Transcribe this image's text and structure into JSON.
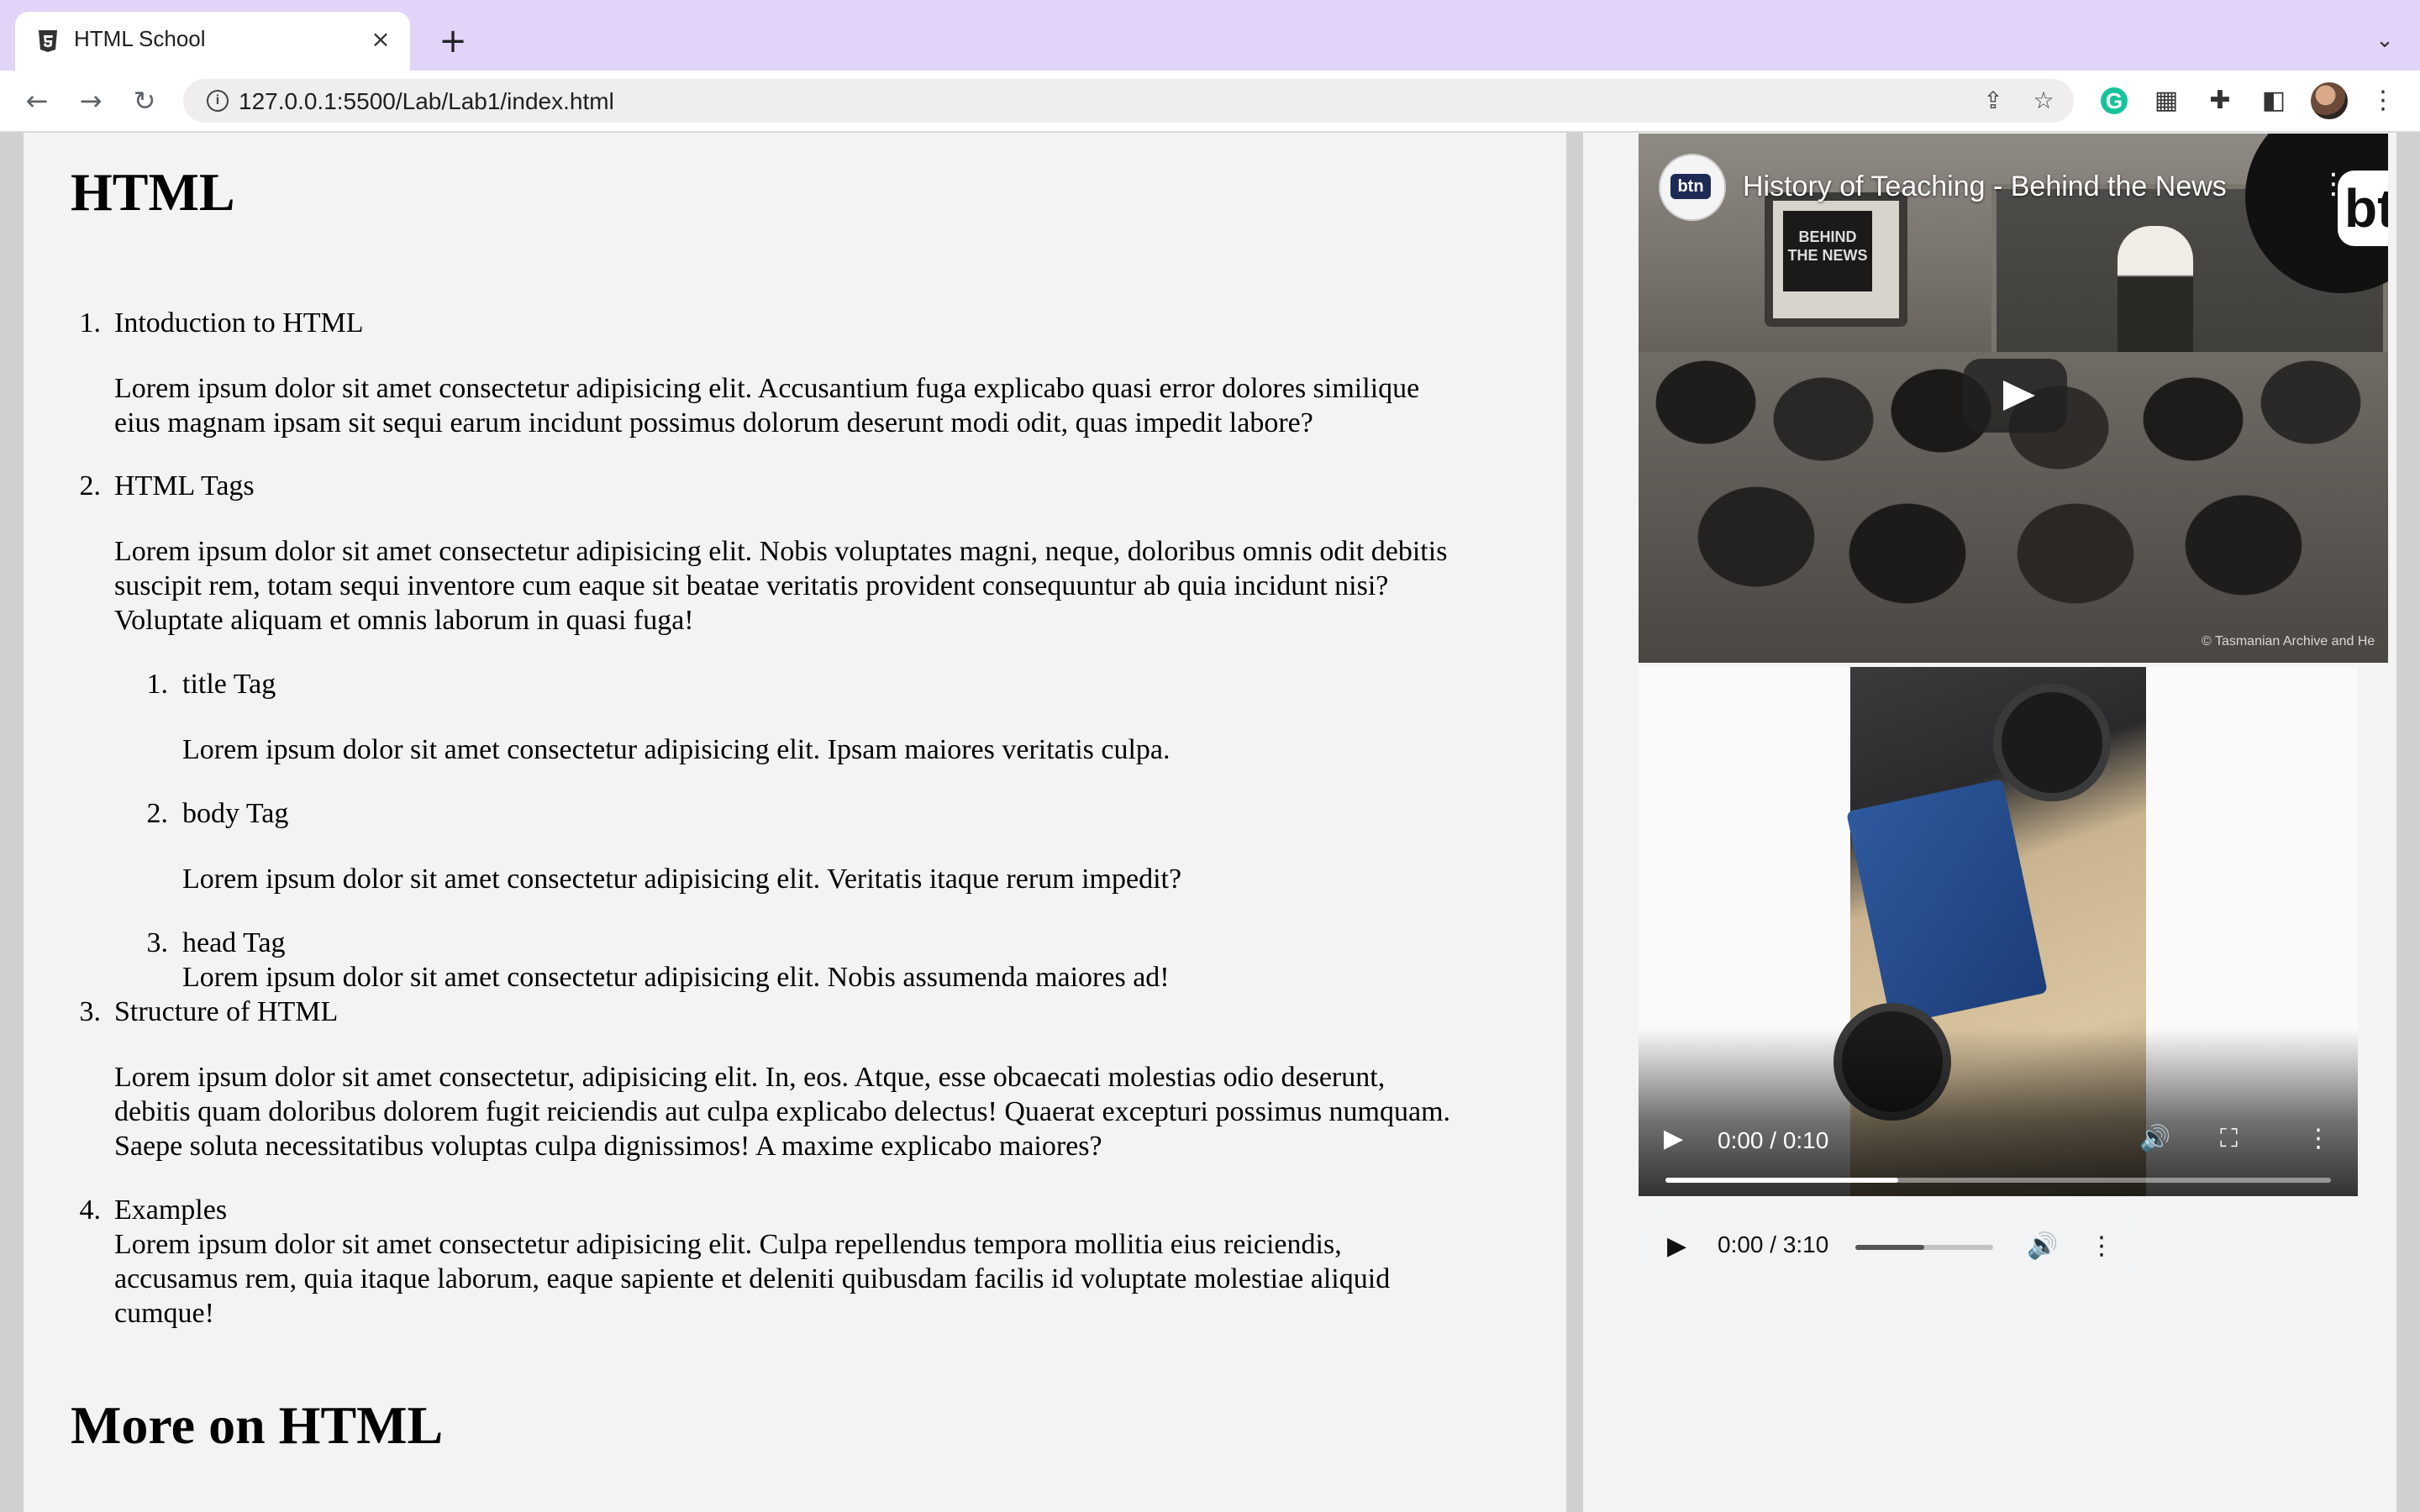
{
  "browser": {
    "tab_title": "HTML School",
    "url": "127.0.0.1:5500/Lab/Lab1/index.html",
    "icons": [
      "html5-icon",
      "close-icon",
      "plus-icon",
      "chevron-down-icon",
      "back-icon",
      "forward-icon",
      "reload-icon",
      "info-icon",
      "share-icon",
      "star-icon",
      "grammarly-icon",
      "calendar-icon",
      "puzzle-icon",
      "sidepanel-icon",
      "avatar",
      "kebab-icon"
    ]
  },
  "page": {
    "heading": "HTML",
    "heading2": "More on HTML",
    "items": [
      {
        "num": "1.",
        "title": "Intoduction to HTML",
        "lines": [
          "Lorem ipsum dolor sit amet consectetur adipisicing elit. Accusantium fuga explicabo quasi error dolores similique",
          "eius magnam ipsam sit sequi earum incidunt possimus dolorum deserunt modi odit, quas impedit labore?"
        ]
      },
      {
        "num": "2.",
        "title": "HTML Tags",
        "lines": [
          "Lorem ipsum dolor sit amet consectetur adipisicing elit. Nobis voluptates magni, neque, doloribus omnis odit debitis",
          "suscipit rem, totam sequi inventore cum eaque sit beatae veritatis provident consequuntur ab quia incidunt nisi?",
          "Voluptate aliquam et omnis laborum in quasi fuga!"
        ],
        "subitems": [
          {
            "num": "1.",
            "title": "title Tag",
            "text": "Lorem ipsum dolor sit amet consectetur adipisicing elit. Ipsam maiores veritatis culpa."
          },
          {
            "num": "2.",
            "title": "body Tag",
            "text": "Lorem ipsum dolor sit amet consectetur adipisicing elit. Veritatis itaque rerum impedit?"
          },
          {
            "num": "3.",
            "title": "head Tag",
            "text": "Lorem ipsum dolor sit amet consectetur adipisicing elit. Nobis assumenda maiores ad!"
          }
        ]
      },
      {
        "num": "3.",
        "title": "Structure of HTML",
        "lines": [
          "Lorem ipsum dolor sit amet consectetur, adipisicing elit. In, eos. Atque, esse obcaecati molestias odio deserunt,",
          "debitis quam doloribus dolorem fugit reiciendis aut culpa explicabo delectus! Quaerat excepturi possimus numquam.",
          "Saepe soluta necessitatibus voluptas culpa dignissimos! A maxime explicabo maiores?"
        ]
      },
      {
        "num": "4.",
        "title": "Examples",
        "lines": [
          "Lorem ipsum dolor sit amet consectetur adipisicing elit. Culpa repellendus tempora mollitia eius reiciendis,",
          "accusamus rem, quia itaque laborum, eaque sapiente et deleniti quibusdam facilis id voluptate molestiae aliquid",
          "cumque!"
        ]
      }
    ]
  },
  "media": {
    "youtube": {
      "channel_logo": "btn",
      "title": "History of Teaching - Behind the News",
      "tv_text": "BEHIND THE NEWS",
      "corner_logo": "bt",
      "credit": "© Tasmanian Archive and He"
    },
    "video": {
      "time": "0:00 / 0:10",
      "progress": 0.35
    },
    "audio": {
      "time": "0:00 / 3:10",
      "volume": 0.5
    }
  }
}
